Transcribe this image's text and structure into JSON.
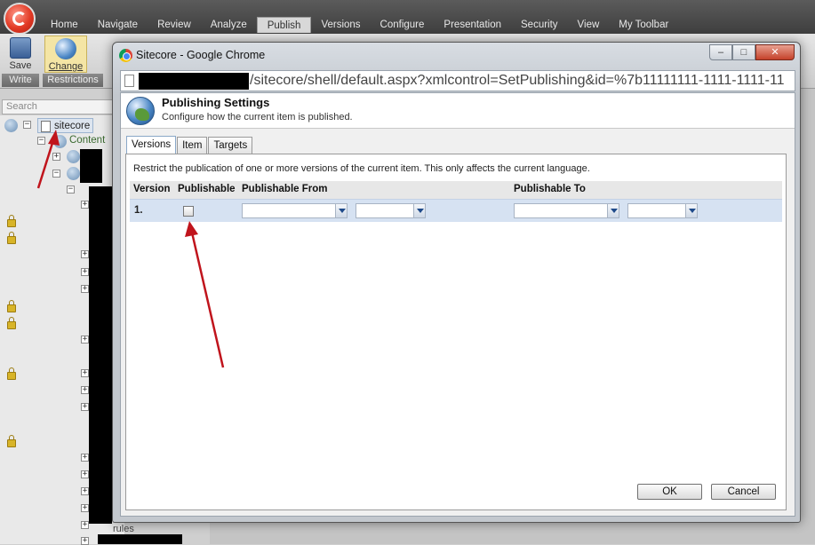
{
  "shell": {
    "menu_tabs": [
      "Home",
      "Navigate",
      "Review",
      "Analyze",
      "Publish",
      "Versions",
      "Configure",
      "Presentation",
      "Security",
      "View",
      "My Toolbar"
    ],
    "ribbon": {
      "save_label": "Save",
      "save_group": "Write",
      "change_label": "Change",
      "change_group": "Restrictions"
    },
    "search_placeholder": "Search",
    "tree": {
      "root_label": "sitecore",
      "content_label": "Content",
      "faint_label": "rules"
    }
  },
  "window": {
    "title": "Sitecore - Google Chrome",
    "controls": {
      "minimize": "–",
      "maximize": "□",
      "close": "✕"
    },
    "url_visible": "/sitecore/shell/default.aspx?xmlcontrol=SetPublishing&id=%7b11111111-1111-1111-11"
  },
  "dialog": {
    "title": "Publishing Settings",
    "subtitle": "Configure how the current item is published.",
    "tabs": [
      "Versions",
      "Item",
      "Targets"
    ],
    "active_tab": "Versions",
    "description": "Restrict the publication of one or more versions of the current item. This only affects the current language.",
    "columns": {
      "version": "Version",
      "publishable": "Publishable",
      "from": "Publishable From",
      "to": "Publishable To"
    },
    "rows": [
      {
        "version": "1.",
        "publishable": false,
        "from_date": "",
        "from_time": "",
        "to_date": "",
        "to_time": ""
      }
    ],
    "ok_label": "OK",
    "cancel_label": "Cancel"
  },
  "colors": {
    "annotation_arrow": "#c0141c",
    "row_highlight": "#d6e2f2"
  }
}
